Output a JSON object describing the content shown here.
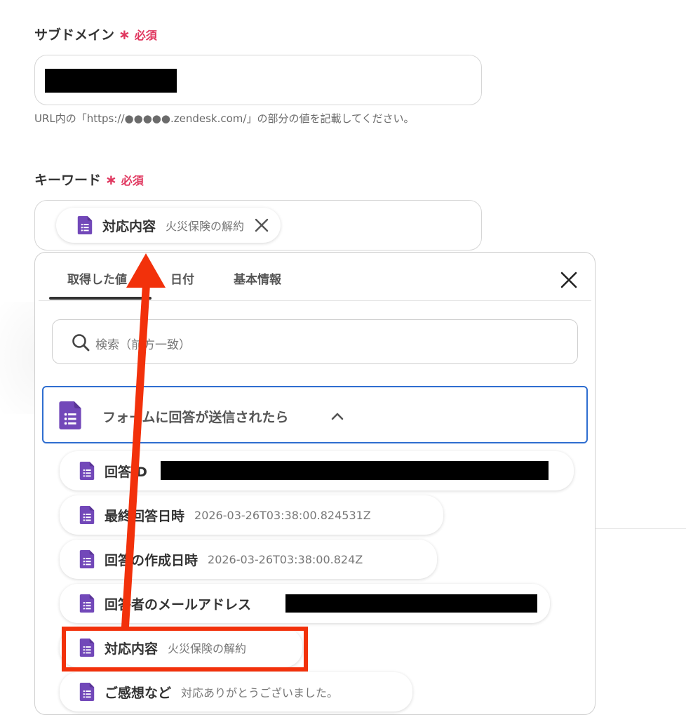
{
  "subdomain": {
    "label": "サブドメイン",
    "required_star": "∗",
    "required_text": "必須",
    "hint": "URL内の「https://●●●●●.zendesk.com/」の部分の値を記載してください。"
  },
  "keyword": {
    "label": "キーワード",
    "required_star": "∗",
    "required_text": "必須",
    "chip": {
      "name": "対応内容",
      "value": "火災保険の解約"
    }
  },
  "picker": {
    "tabs": [
      "取得した値",
      "日付",
      "基本情報"
    ],
    "active_tab": 0,
    "search_placeholder": "検索（前方一致）",
    "section_title": "フォームに回答が送信されたら",
    "items": [
      {
        "name": "回答ID",
        "value": ""
      },
      {
        "name": "最終回答日時",
        "value": "2026-03-26T03:38:00.824531Z"
      },
      {
        "name": "回答の作成日時",
        "value": "2026-03-26T03:38:00.824Z"
      },
      {
        "name": "回答者のメールアドレス",
        "value": ""
      },
      {
        "name": "対応内容",
        "value": "火災保険の解約"
      },
      {
        "name": "ご感想など",
        "value": "対応ありがとうございました。"
      }
    ]
  },
  "colors": {
    "required": "#e0375f",
    "forms_purple": "#7248b9",
    "section_border": "#2f6ed0",
    "annotation_red": "#f2310b"
  },
  "icons": {
    "form": "google-forms-icon",
    "search": "search-icon",
    "close": "close-icon",
    "chevron": "chevron-up-icon"
  }
}
